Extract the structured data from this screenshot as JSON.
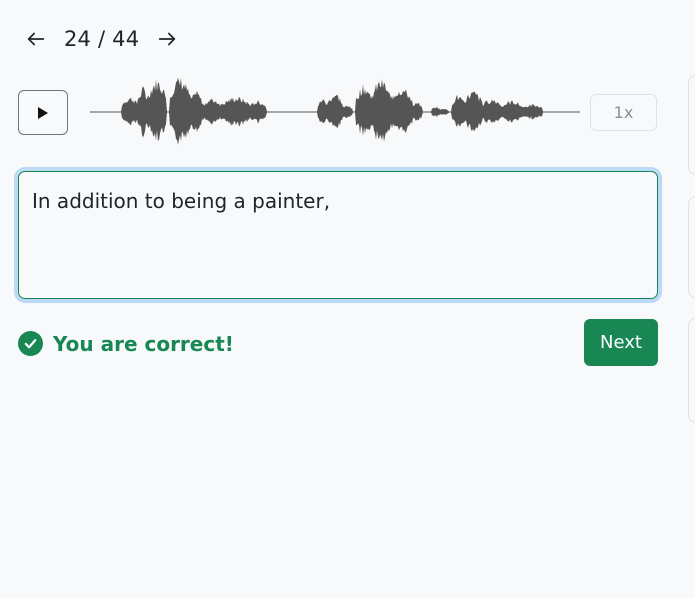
{
  "pager": {
    "current": "24",
    "separator": "/",
    "total": "44",
    "label": "24 / 44",
    "prev_icon": "arrow-left-icon",
    "next_icon": "arrow-right-icon"
  },
  "audio": {
    "play_icon": "play-icon",
    "speed_label": "1x"
  },
  "answer": {
    "text": "In addition to being a painter,"
  },
  "feedback": {
    "icon": "check-circle-icon",
    "message": "You are correct!"
  },
  "actions": {
    "next_label": "Next"
  },
  "colors": {
    "success": "#198754",
    "focus_ring": "#bcd9f5",
    "waveform": "#555555",
    "background": "#f8f9fb"
  }
}
